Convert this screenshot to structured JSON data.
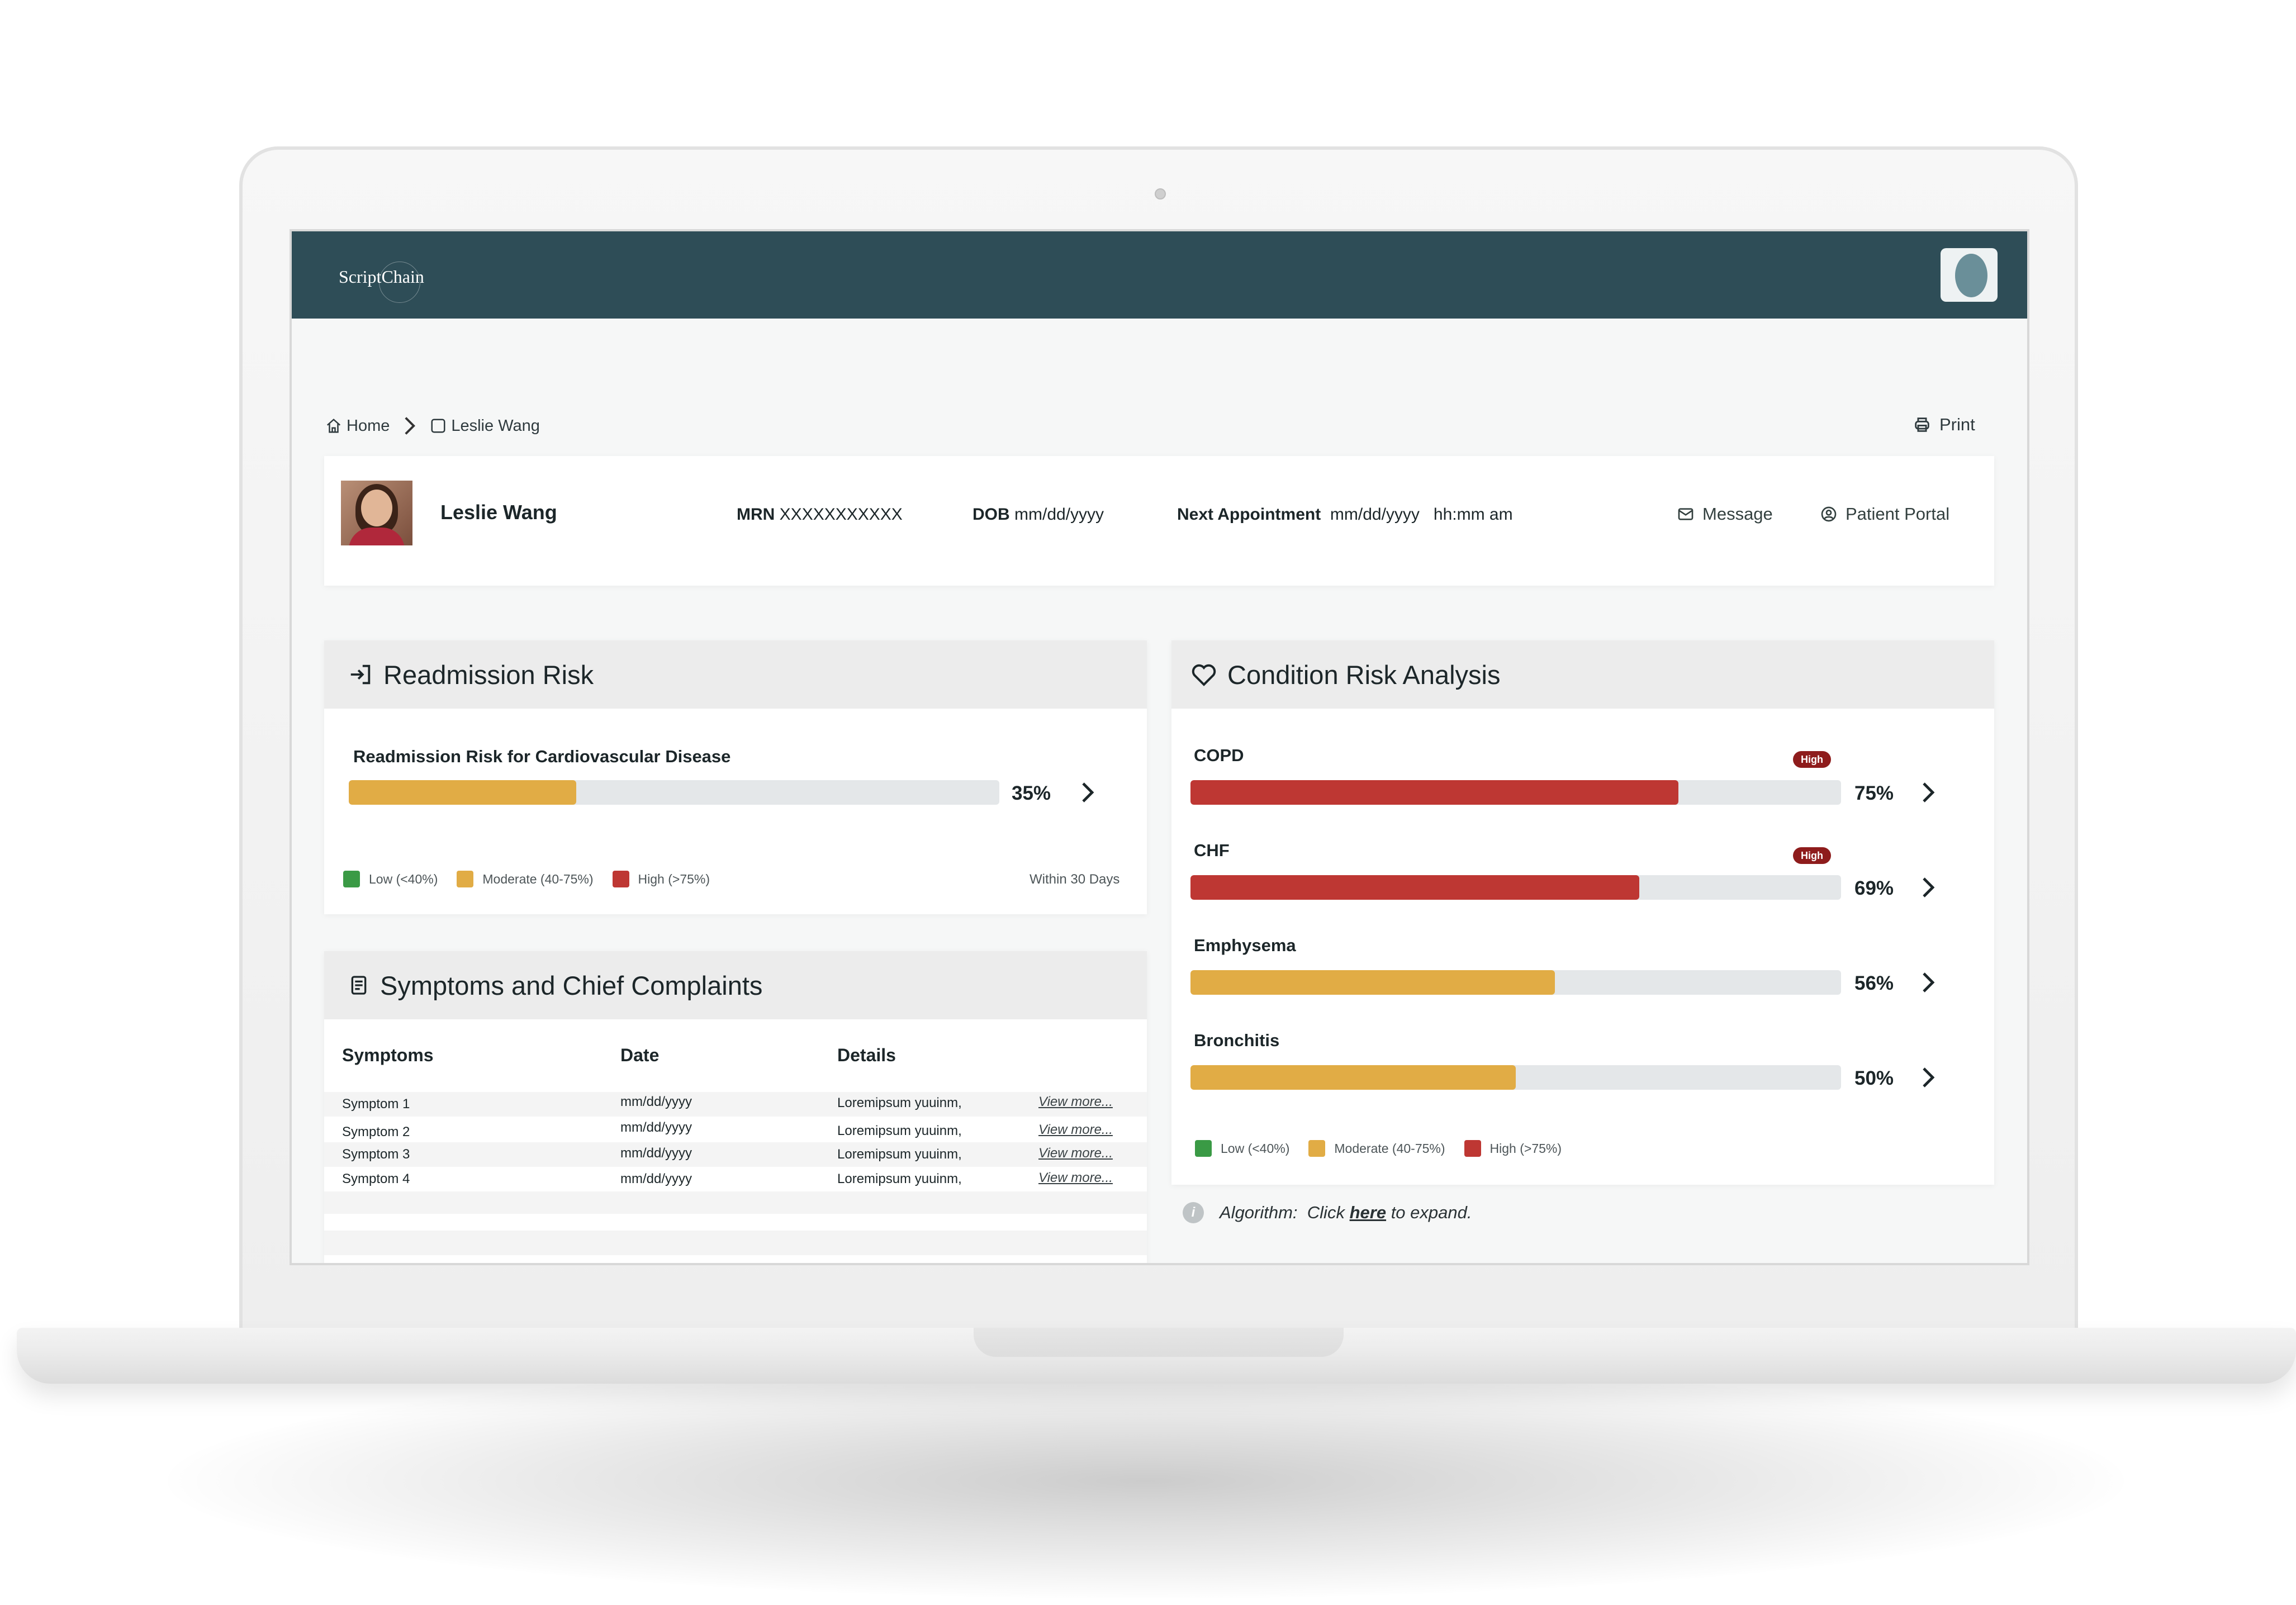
{
  "app": {
    "logo": "ScriptChain"
  },
  "breadcrumb": {
    "home": "Home",
    "current": "Leslie Wang"
  },
  "actions": {
    "print": "Print",
    "message": "Message",
    "portal": "Patient Portal"
  },
  "patient": {
    "name": "Leslie Wang",
    "mrn_label": "MRN",
    "mrn": "XXXXXXXXXXX",
    "dob_label": "DOB",
    "dob": "mm/dd/yyyy",
    "appt_label": "Next Appointment",
    "appt": "mm/dd/yyyy   hh:mm am"
  },
  "readmission": {
    "title": "Readmission Risk",
    "label": "Readmission Risk for Cardiovascular Disease",
    "value": 35,
    "value_text": "35%",
    "level": "moderate",
    "within": "Within 30 Days"
  },
  "legend": {
    "low": "Low (<40%)",
    "moderate": "Moderate (40-75%)",
    "high": "High (>75%)"
  },
  "colors": {
    "low": "#3a9a45",
    "moderate": "#e1ac45",
    "high": "#be3733",
    "header": "#2e4d57",
    "badge": "#8e1c1c"
  },
  "conditions": {
    "title": "Condition Risk Analysis",
    "items": [
      {
        "name": "COPD",
        "value": 75,
        "value_text": "75%",
        "level": "high",
        "badge": "High"
      },
      {
        "name": "CHF",
        "value": 69,
        "value_text": "69%",
        "level": "high",
        "badge": "High"
      },
      {
        "name": "Emphysema",
        "value": 56,
        "value_text": "56%",
        "level": "moderate",
        "badge": ""
      },
      {
        "name": "Bronchitis",
        "value": 50,
        "value_text": "50%",
        "level": "moderate",
        "badge": ""
      }
    ]
  },
  "symptoms": {
    "title": "Symptoms and Chief Complaints",
    "columns": [
      "Symptoms",
      "Date",
      "Details"
    ],
    "rows": [
      {
        "symptom": "Symptom 1",
        "date": "mm/dd/yyyy",
        "details": "Loremipsum yuuinm,",
        "link": "View more..."
      },
      {
        "symptom": "Symptom 2",
        "date": "mm/dd/yyyy",
        "details": "Loremipsum yuuinm,",
        "link": "View more..."
      },
      {
        "symptom": "Symptom 3",
        "date": "mm/dd/yyyy",
        "details": "Loremipsum yuuinm,",
        "link": "View more..."
      },
      {
        "symptom": "Symptom 4",
        "date": "mm/dd/yyyy",
        "details": "Loremipsum yuuinm,",
        "link": "View more..."
      }
    ]
  },
  "algorithm": {
    "prefix": "Algorithm:",
    "click": "Click",
    "here": "here",
    "suffix": "to expand.",
    "icon_letter": "i"
  },
  "icons": [
    "home-icon",
    "chevron-right-icon",
    "square-icon",
    "printer-icon",
    "mail-icon",
    "user-circle-icon",
    "sign-in-icon",
    "heart-icon",
    "document-icon",
    "info-icon"
  ]
}
